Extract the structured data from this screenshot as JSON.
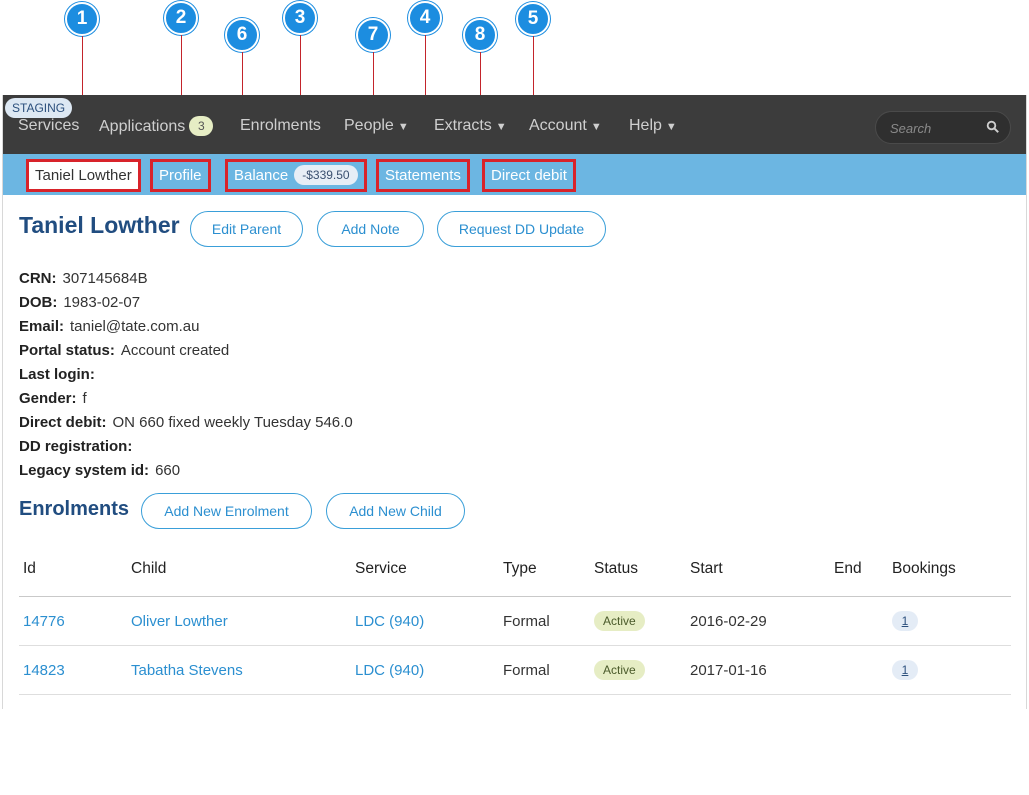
{
  "callouts": [
    "1",
    "2",
    "3",
    "4",
    "5",
    "6",
    "7",
    "8"
  ],
  "env_badge": "STAGING",
  "topnav": {
    "items": [
      "Services",
      "Applications",
      "Enrolments",
      "People",
      "Extracts",
      "Account",
      "Help"
    ],
    "applications_count": "3",
    "search_placeholder": "Search"
  },
  "subnav": {
    "tabs": [
      "Taniel Lowther",
      "Profile",
      "Balance",
      "Statements",
      "Direct debit"
    ],
    "balance_amount": "-$339.50"
  },
  "parent": {
    "name": "Taniel Lowther",
    "actions": [
      "Edit Parent",
      "Add Note",
      "Request DD Update"
    ],
    "fields": [
      {
        "label": "CRN:",
        "value": "307145684B"
      },
      {
        "label": "DOB:",
        "value": "1983-02-07"
      },
      {
        "label": "Email:",
        "value": "taniel@tate.com.au"
      },
      {
        "label": "Portal status:",
        "value": "Account created"
      },
      {
        "label": "Last login:",
        "value": ""
      },
      {
        "label": "Gender:",
        "value": "f"
      },
      {
        "label": "Direct debit:",
        "value": "ON 660 fixed weekly Tuesday 546.0"
      },
      {
        "label": "DD registration:",
        "value": ""
      },
      {
        "label": "Legacy system id:",
        "value": "660"
      }
    ]
  },
  "enrolments": {
    "title": "Enrolments",
    "actions": [
      "Add New Enrolment",
      "Add New Child"
    ],
    "columns": [
      "Id",
      "Child",
      "Service",
      "Type",
      "Status",
      "Start",
      "End",
      "Bookings"
    ],
    "rows": [
      {
        "id": "14776",
        "child": "Oliver Lowther",
        "service": "LDC (940)",
        "type": "Formal",
        "status": "Active",
        "start": "2016-02-29",
        "end": "",
        "bookings": "1"
      },
      {
        "id": "14823",
        "child": "Tabatha Stevens",
        "service": "LDC (940)",
        "type": "Formal",
        "status": "Active",
        "start": "2017-01-16",
        "end": "",
        "bookings": "1"
      }
    ]
  },
  "colors": {
    "topnav_bg": "#3c3c3c",
    "subnav_bg": "#6cb6e2",
    "heading": "#214d80",
    "link": "#2b8fd0",
    "callout": "#1c8de0",
    "highlight_border": "#d8232a"
  }
}
